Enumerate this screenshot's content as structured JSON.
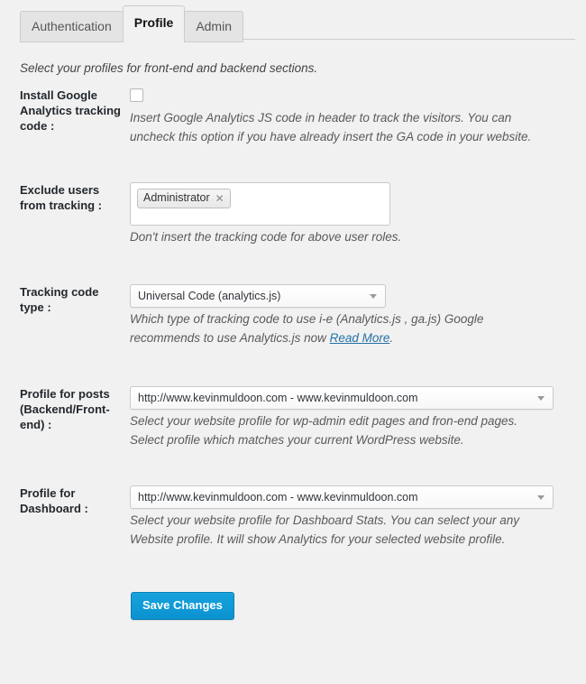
{
  "tabs": [
    {
      "id": "authentication",
      "label": "Authentication",
      "active": false
    },
    {
      "id": "profile",
      "label": "Profile",
      "active": true
    },
    {
      "id": "admin",
      "label": "Admin",
      "active": false
    }
  ],
  "intro": "Select your profiles for front-end and backend sections.",
  "rows": {
    "install_code": {
      "label": "Install Google Analytics tracking code :",
      "checkbox_checked": false,
      "description": "Insert Google Analytics JS code in header to track the visitors. You can uncheck this option if you have already insert the GA code in your website."
    },
    "exclude_users": {
      "label": "Exclude users from tracking :",
      "tokens": [
        "Administrator"
      ],
      "token_remove_glyph": "✕",
      "description": "Don't insert the tracking code for above user roles."
    },
    "tracking_type": {
      "label": "Tracking code type :",
      "value": "Universal Code (analytics.js)",
      "description_before": "Which type of tracking code to use i-e (Analytics.js , ga.js) Google recommends to use Analytics.js now ",
      "link_text": "Read More",
      "description_after": "."
    },
    "profile_posts": {
      "label": "Profile for posts (Backend/Front-end) :",
      "value": "http://www.kevinmuldoon.com - www.kevinmuldoon.com",
      "description": "Select your website profile for wp-admin edit pages and fron-end pages. Select profile which matches your current WordPress website."
    },
    "profile_dashboard": {
      "label": "Profile for Dashboard :",
      "value": "http://www.kevinmuldoon.com - www.kevinmuldoon.com",
      "description": "Select your website profile for Dashboard Stats. You can select your any Website profile. It will show Analytics for your selected website profile."
    }
  },
  "submit": {
    "label": "Save Changes"
  },
  "colors": {
    "page_background": "#f1f1f1",
    "primary_button": "#0e9ad7",
    "link": "#2472a4",
    "label_text": "#23282d",
    "description_text": "#5a5a5a"
  }
}
